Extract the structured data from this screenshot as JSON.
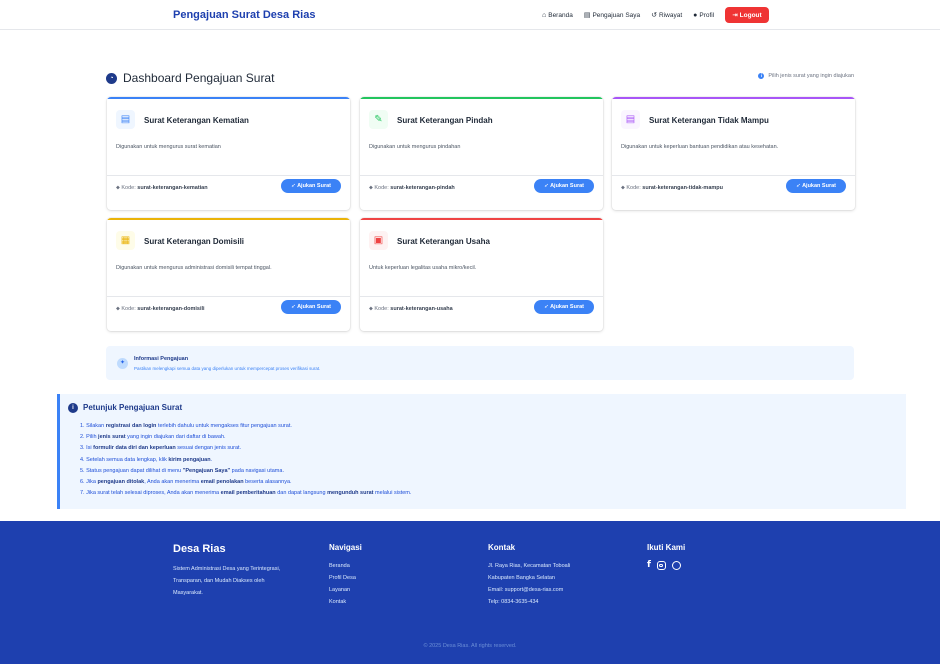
{
  "nav": {
    "brand": "Pengajuan Surat Desa Rias",
    "items": [
      {
        "icon": "home-icon",
        "glyph": "⌂",
        "label": "Beranda"
      },
      {
        "icon": "document-icon",
        "glyph": "▤",
        "label": "Pengajuan Saya"
      },
      {
        "icon": "history-icon",
        "glyph": "↺",
        "label": "Riwayat"
      },
      {
        "icon": "user-icon",
        "glyph": "●",
        "label": "Profil"
      }
    ],
    "logout": "Logout"
  },
  "dashboard": {
    "title": "Dashboard Pengajuan Surat",
    "hint": "Pilih jenis surat yang ingin diajukan"
  },
  "cards": [
    {
      "title": "Surat Keterangan Kematian",
      "desc": "Digunakan untuk mengurus surat kematian",
      "code_label": "Kode:",
      "code": "surat-keterangan-kematian",
      "button": "Ajukan Surat",
      "color": "#3b82f6",
      "bg": "#eff6ff",
      "icon": "document-icon"
    },
    {
      "title": "Surat Keterangan Pindah",
      "desc": "Digunakan untuk mengurus pindahan",
      "code_label": "Kode:",
      "code": "surat-keterangan-pindah",
      "button": "Ajukan Surat",
      "color": "#22c55e",
      "bg": "#f0fdf4",
      "icon": "edit-document-icon"
    },
    {
      "title": "Surat Keterangan Tidak Mampu",
      "desc": "Digunakan untuk keperluan bantuan pendidikan atau kesehatan.",
      "code_label": "Kode:",
      "code": "surat-keterangan-tidak-mampu",
      "button": "Ajukan Surat",
      "color": "#a855f7",
      "bg": "#faf5ff",
      "icon": "document-icon"
    },
    {
      "title": "Surat Keterangan Domisili",
      "desc": "Digunakan untuk mengurus administrasi domisili tempat tinggal.",
      "code_label": "Kode:",
      "code": "surat-keterangan-domisili",
      "button": "Ajukan Surat",
      "color": "#eab308",
      "bg": "#fefce8",
      "icon": "clipboard-icon"
    },
    {
      "title": "Surat Keterangan Usaha",
      "desc": "Untuk keperluan legalitas usaha mikro/kecil.",
      "code_label": "Kode:",
      "code": "surat-keterangan-usaha",
      "button": "Ajukan Surat",
      "color": "#ef4444",
      "bg": "#fef2f2",
      "icon": "invoice-icon"
    }
  ],
  "info": {
    "title": "Informasi Pengajuan",
    "text": "Pastikan melengkapi semua data yang diperlukan untuk mempercepat proses verifikasi surat."
  },
  "guide": {
    "title": "Petunjuk Pengajuan Surat",
    "steps": [
      [
        "1. Silakan ",
        "registrasi dan login",
        " terlebih dahulu untuk mengakses fitur pengajuan surat."
      ],
      [
        "2. Pilih ",
        "jenis surat",
        " yang ingin diajukan dari daftar di bawah."
      ],
      [
        "3. Isi ",
        "formulir data diri dan keperluan",
        " sesuai dengan jenis surat."
      ],
      [
        "4. Setelah semua data lengkap, klik ",
        "kirim pengajuan",
        "."
      ],
      [
        "5. Status pengajuan dapat dilihat di menu ",
        "\"Pengajuan Saya\"",
        " pada navigasi utama."
      ],
      [
        "6. Jika ",
        "pengajuan ditolak",
        ", Anda akan menerima ",
        "email penolakan",
        " beserta alasannya."
      ],
      [
        "7. Jika surat telah selesai diproses, Anda akan menerima ",
        "email pemberitahuan",
        " dan dapat langsung ",
        "mengunduh surat",
        " melalui sistem."
      ]
    ]
  },
  "footer": {
    "about_title": "Desa Rias",
    "about_text": [
      "Sistem Administrasi Desa yang Terintegrasi,",
      "Transparan, dan Mudah Diakses oleh",
      "Masyarakat."
    ],
    "nav_title": "Navigasi",
    "nav_items": [
      "Beranda",
      "Profil Desa",
      "Layanan",
      "Kontak"
    ],
    "contact_title": "Kontak",
    "contact_items": [
      "Jl. Raya Rias, Kecamatan Toboali",
      "Kabupaten Bangka Selatan",
      "Email: support@desa-rias.com",
      "Telp: 0834-3635-434"
    ],
    "social_title": "Ikuti Kami",
    "copyright": "© 2025 Desa Rias. All rights reserved."
  }
}
